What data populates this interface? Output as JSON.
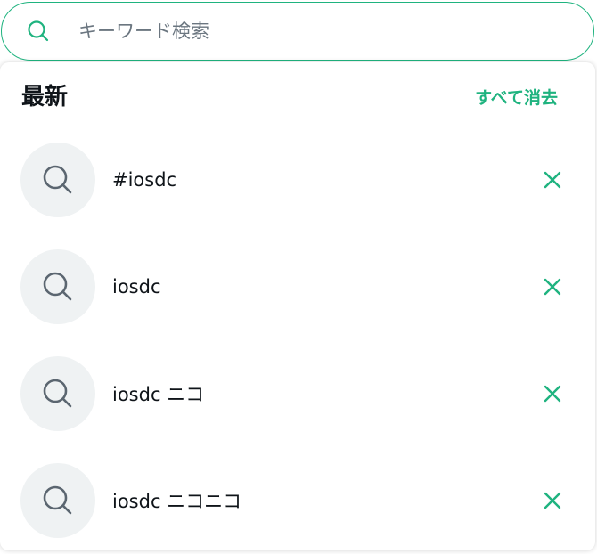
{
  "search": {
    "placeholder": "キーワード検索",
    "value": ""
  },
  "recent": {
    "title": "最新",
    "clear_all_label": "すべて消去",
    "items": [
      {
        "label": "#iosdc"
      },
      {
        "label": "iosdc"
      },
      {
        "label": "iosdc ニコ"
      },
      {
        "label": "iosdc ニコニコ"
      }
    ]
  },
  "colors": {
    "accent": "#1fb37f",
    "icon_gray": "#5b6670",
    "avatar_bg": "#eff2f3",
    "text": "#0f1419"
  },
  "icons": {
    "search": "search-icon",
    "remove": "close-icon"
  }
}
